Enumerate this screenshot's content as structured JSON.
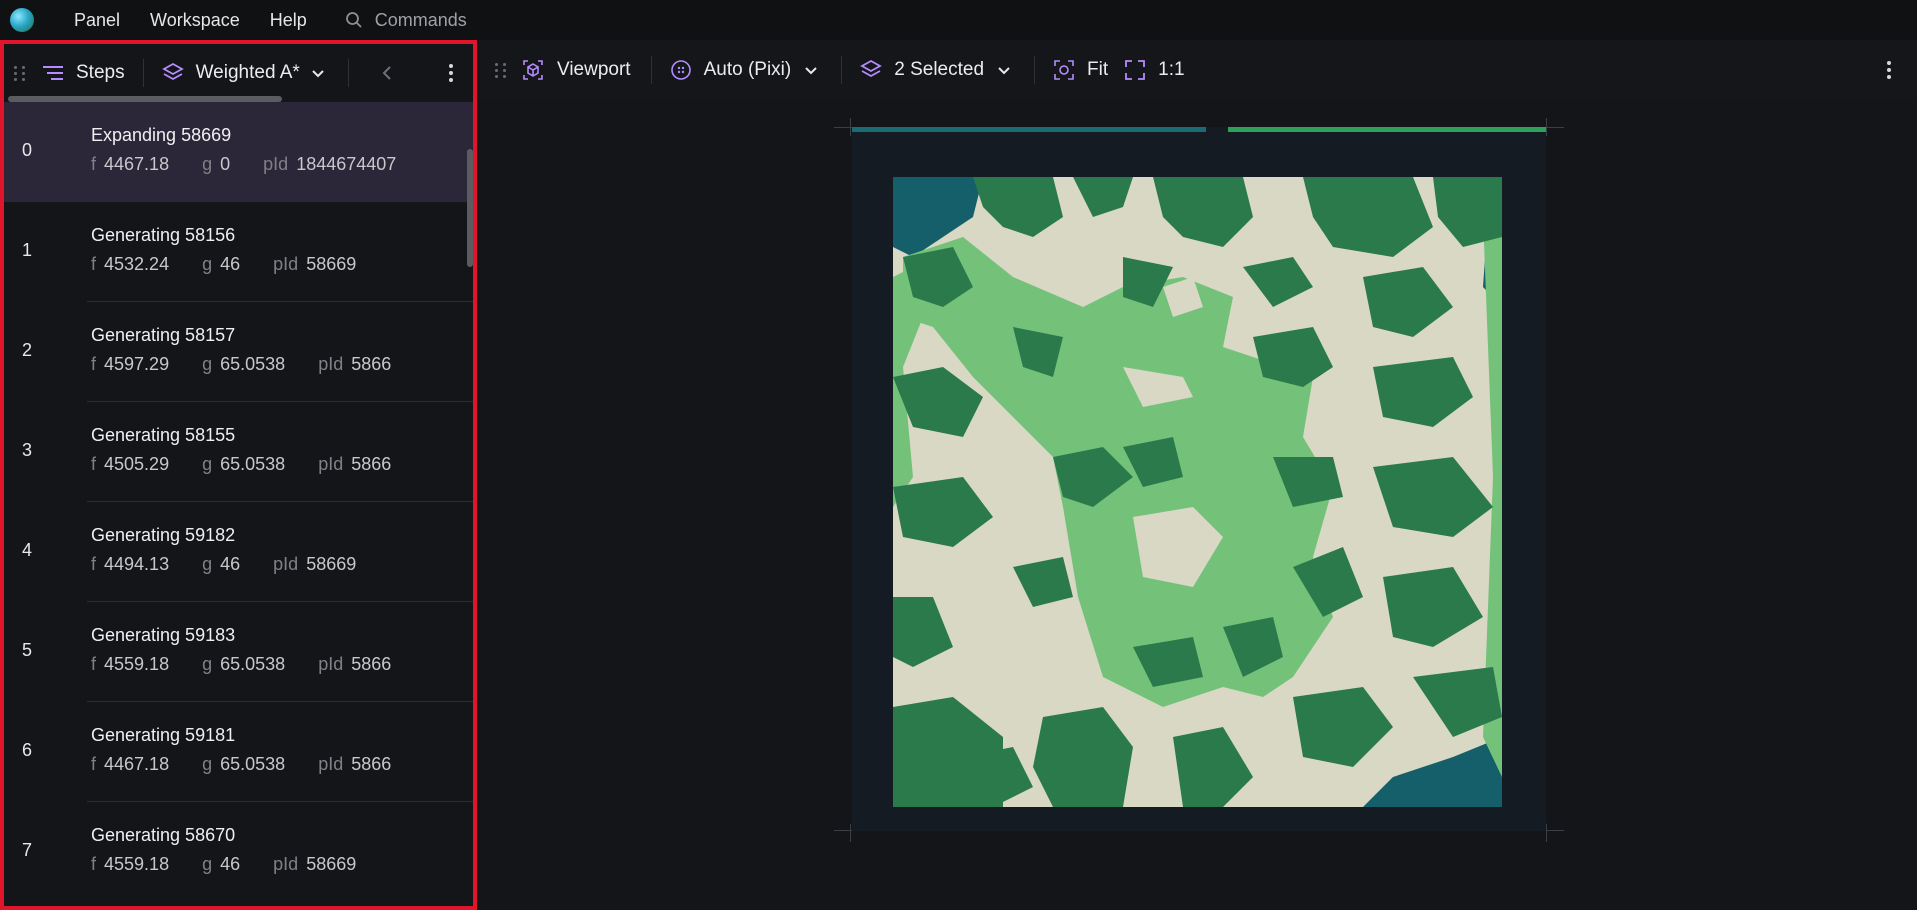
{
  "menubar": {
    "items": [
      "Panel",
      "Workspace",
      "Help"
    ],
    "commands_label": "Commands"
  },
  "steps_panel": {
    "steps_label": "Steps",
    "algorithm": "Weighted A*",
    "steps": [
      {
        "index": "0",
        "title": "Expanding 58669",
        "f": "4467.18",
        "g": "0",
        "pid": "1844674407"
      },
      {
        "index": "1",
        "title": "Generating 58156",
        "f": "4532.24",
        "g": "46",
        "pid": "58669"
      },
      {
        "index": "2",
        "title": "Generating 58157",
        "f": "4597.29",
        "g": "65.0538",
        "pid": "5866"
      },
      {
        "index": "3",
        "title": "Generating 58155",
        "f": "4505.29",
        "g": "65.0538",
        "pid": "5866"
      },
      {
        "index": "4",
        "title": "Generating 59182",
        "f": "4494.13",
        "g": "46",
        "pid": "58669"
      },
      {
        "index": "5",
        "title": "Generating 59183",
        "f": "4559.18",
        "g": "65.0538",
        "pid": "5866"
      },
      {
        "index": "6",
        "title": "Generating 59181",
        "f": "4467.18",
        "g": "65.0538",
        "pid": "5866"
      },
      {
        "index": "7",
        "title": "Generating 58670",
        "f": "4559.18",
        "g": "46",
        "pid": "58669"
      }
    ],
    "labels": {
      "f": "f",
      "g": "g",
      "pid": "pId"
    }
  },
  "viewport_toolbar": {
    "viewport_label": "Viewport",
    "renderer": "Auto (Pixi)",
    "layers": "2 Selected",
    "fit_label": "Fit",
    "zoom_label": "1:1"
  },
  "colors": {
    "accent": "#b48cff",
    "highlight_border": "#e0142a",
    "selected_row": "#2b2638",
    "map_floor": "#d9d8c4",
    "map_tree": "#2a7a4b",
    "map_grass": "#74c27a",
    "map_water": "#155f6b"
  }
}
